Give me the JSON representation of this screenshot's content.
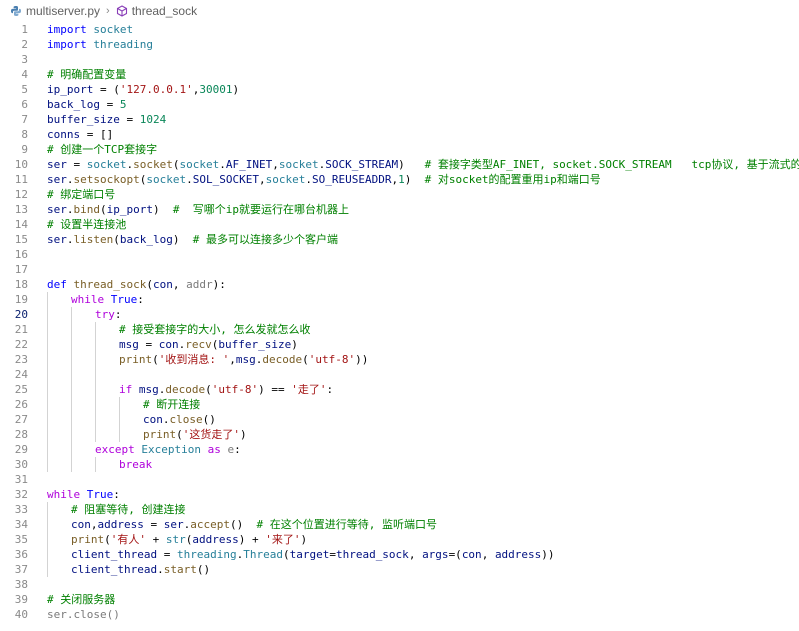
{
  "breadcrumb": {
    "file": "multiserver.py",
    "symbol": "thread_sock"
  },
  "active_line": 20,
  "lines": [
    {
      "n": "1",
      "indent": 0,
      "tokens": [
        [
          "kw",
          "import"
        ],
        [
          "txt",
          " "
        ],
        [
          "mod",
          "socket"
        ]
      ]
    },
    {
      "n": "2",
      "indent": 0,
      "tokens": [
        [
          "kw",
          "import"
        ],
        [
          "txt",
          " "
        ],
        [
          "mod",
          "threading"
        ]
      ]
    },
    {
      "n": "3",
      "indent": 0,
      "tokens": []
    },
    {
      "n": "4",
      "indent": 0,
      "tokens": [
        [
          "cmt",
          "# 明确配置变量"
        ]
      ]
    },
    {
      "n": "5",
      "indent": 0,
      "tokens": [
        [
          "var",
          "ip_port"
        ],
        [
          "txt",
          " = ("
        ],
        [
          "str",
          "'127.0.0.1'"
        ],
        [
          "txt",
          ","
        ],
        [
          "num",
          "30001"
        ],
        [
          "txt",
          ")"
        ]
      ]
    },
    {
      "n": "6",
      "indent": 0,
      "tokens": [
        [
          "var",
          "back_log"
        ],
        [
          "txt",
          " = "
        ],
        [
          "num",
          "5"
        ]
      ]
    },
    {
      "n": "7",
      "indent": 0,
      "tokens": [
        [
          "var",
          "buffer_size"
        ],
        [
          "txt",
          " = "
        ],
        [
          "num",
          "1024"
        ]
      ]
    },
    {
      "n": "8",
      "indent": 0,
      "tokens": [
        [
          "var",
          "conns"
        ],
        [
          "txt",
          " = []"
        ]
      ]
    },
    {
      "n": "9",
      "indent": 0,
      "tokens": [
        [
          "cmt",
          "# 创建一个TCP套接字"
        ]
      ]
    },
    {
      "n": "10",
      "indent": 0,
      "tokens": [
        [
          "var",
          "ser"
        ],
        [
          "txt",
          " = "
        ],
        [
          "mod",
          "socket"
        ],
        [
          "txt",
          "."
        ],
        [
          "fn",
          "socket"
        ],
        [
          "txt",
          "("
        ],
        [
          "mod",
          "socket"
        ],
        [
          "txt",
          "."
        ],
        [
          "var",
          "AF_INET"
        ],
        [
          "txt",
          ","
        ],
        [
          "mod",
          "socket"
        ],
        [
          "txt",
          "."
        ],
        [
          "var",
          "SOCK_STREAM"
        ],
        [
          "txt",
          ")   "
        ],
        [
          "cmt",
          "# 套接字类型AF_INET, socket.SOCK_STREAM   tcp协议, 基于流式的协议"
        ]
      ]
    },
    {
      "n": "11",
      "indent": 0,
      "tokens": [
        [
          "var",
          "ser"
        ],
        [
          "txt",
          "."
        ],
        [
          "fn",
          "setsockopt"
        ],
        [
          "txt",
          "("
        ],
        [
          "mod",
          "socket"
        ],
        [
          "txt",
          "."
        ],
        [
          "var",
          "SOL_SOCKET"
        ],
        [
          "txt",
          ","
        ],
        [
          "mod",
          "socket"
        ],
        [
          "txt",
          "."
        ],
        [
          "var",
          "SO_REUSEADDR"
        ],
        [
          "txt",
          ","
        ],
        [
          "num",
          "1"
        ],
        [
          "txt",
          ")  "
        ],
        [
          "cmt",
          "# 对socket的配置重用ip和端口号"
        ]
      ]
    },
    {
      "n": "12",
      "indent": 0,
      "tokens": [
        [
          "cmt",
          "# 绑定端口号"
        ]
      ]
    },
    {
      "n": "13",
      "indent": 0,
      "tokens": [
        [
          "var",
          "ser"
        ],
        [
          "txt",
          "."
        ],
        [
          "fn",
          "bind"
        ],
        [
          "txt",
          "("
        ],
        [
          "var",
          "ip_port"
        ],
        [
          "txt",
          ")  "
        ],
        [
          "cmt",
          "#  写哪个ip就要运行在哪台机器上"
        ]
      ]
    },
    {
      "n": "14",
      "indent": 0,
      "tokens": [
        [
          "cmt",
          "# 设置半连接池"
        ]
      ]
    },
    {
      "n": "15",
      "indent": 0,
      "tokens": [
        [
          "var",
          "ser"
        ],
        [
          "txt",
          "."
        ],
        [
          "fn",
          "listen"
        ],
        [
          "txt",
          "("
        ],
        [
          "var",
          "back_log"
        ],
        [
          "txt",
          ")  "
        ],
        [
          "cmt",
          "# 最多可以连接多少个客户端"
        ]
      ]
    },
    {
      "n": "16",
      "indent": 0,
      "tokens": []
    },
    {
      "n": "17",
      "indent": 0,
      "tokens": []
    },
    {
      "n": "18",
      "indent": 0,
      "tokens": [
        [
          "kw",
          "def"
        ],
        [
          "txt",
          " "
        ],
        [
          "fn",
          "thread_sock"
        ],
        [
          "txt",
          "("
        ],
        [
          "var",
          "con"
        ],
        [
          "txt",
          ", "
        ],
        [
          "param",
          "addr"
        ],
        [
          "txt",
          "):"
        ]
      ]
    },
    {
      "n": "19",
      "indent": 1,
      "tokens": [
        [
          "kwc",
          "while"
        ],
        [
          "txt",
          " "
        ],
        [
          "kw",
          "True"
        ],
        [
          "txt",
          ":"
        ]
      ]
    },
    {
      "n": "20",
      "indent": 2,
      "tokens": [
        [
          "kwc",
          "try"
        ],
        [
          "txt",
          ":"
        ]
      ]
    },
    {
      "n": "21",
      "indent": 3,
      "tokens": [
        [
          "cmt",
          "# 接受套接字的大小, 怎么发就怎么收"
        ]
      ]
    },
    {
      "n": "22",
      "indent": 3,
      "tokens": [
        [
          "var",
          "msg"
        ],
        [
          "txt",
          " = "
        ],
        [
          "var",
          "con"
        ],
        [
          "txt",
          "."
        ],
        [
          "fn",
          "recv"
        ],
        [
          "txt",
          "("
        ],
        [
          "var",
          "buffer_size"
        ],
        [
          "txt",
          ")"
        ]
      ]
    },
    {
      "n": "23",
      "indent": 3,
      "tokens": [
        [
          "fn",
          "print"
        ],
        [
          "txt",
          "("
        ],
        [
          "str",
          "'收到消息: '"
        ],
        [
          "txt",
          ","
        ],
        [
          "var",
          "msg"
        ],
        [
          "txt",
          "."
        ],
        [
          "fn",
          "decode"
        ],
        [
          "txt",
          "("
        ],
        [
          "str",
          "'utf-8'"
        ],
        [
          "txt",
          "))"
        ]
      ]
    },
    {
      "n": "24",
      "indent": 3,
      "tokens": []
    },
    {
      "n": "25",
      "indent": 3,
      "tokens": [
        [
          "kwc",
          "if"
        ],
        [
          "txt",
          " "
        ],
        [
          "var",
          "msg"
        ],
        [
          "txt",
          "."
        ],
        [
          "fn",
          "decode"
        ],
        [
          "txt",
          "("
        ],
        [
          "str",
          "'utf-8'"
        ],
        [
          "txt",
          ") == "
        ],
        [
          "str",
          "'走了'"
        ],
        [
          "txt",
          ":"
        ]
      ]
    },
    {
      "n": "26",
      "indent": 4,
      "tokens": [
        [
          "cmt",
          "# 断开连接"
        ]
      ]
    },
    {
      "n": "27",
      "indent": 4,
      "tokens": [
        [
          "var",
          "con"
        ],
        [
          "txt",
          "."
        ],
        [
          "fn",
          "close"
        ],
        [
          "txt",
          "()"
        ]
      ]
    },
    {
      "n": "28",
      "indent": 4,
      "tokens": [
        [
          "fn",
          "print"
        ],
        [
          "txt",
          "("
        ],
        [
          "str",
          "'这货走了'"
        ],
        [
          "txt",
          ")"
        ]
      ]
    },
    {
      "n": "29",
      "indent": 2,
      "tokens": [
        [
          "kwc",
          "except"
        ],
        [
          "txt",
          " "
        ],
        [
          "cls",
          "Exception"
        ],
        [
          "txt",
          " "
        ],
        [
          "kwc",
          "as"
        ],
        [
          "txt",
          " "
        ],
        [
          "param",
          "e"
        ],
        [
          "txt",
          ":"
        ]
      ]
    },
    {
      "n": "30",
      "indent": 3,
      "tokens": [
        [
          "kwc",
          "break"
        ]
      ]
    },
    {
      "n": "31",
      "indent": 0,
      "tokens": []
    },
    {
      "n": "32",
      "indent": 0,
      "tokens": [
        [
          "kwc",
          "while"
        ],
        [
          "txt",
          " "
        ],
        [
          "kw",
          "True"
        ],
        [
          "txt",
          ":"
        ]
      ]
    },
    {
      "n": "33",
      "indent": 1,
      "tokens": [
        [
          "cmt",
          "# 阻塞等待, 创建连接"
        ]
      ]
    },
    {
      "n": "34",
      "indent": 1,
      "tokens": [
        [
          "var",
          "con"
        ],
        [
          "txt",
          ","
        ],
        [
          "var",
          "address"
        ],
        [
          "txt",
          " = "
        ],
        [
          "var",
          "ser"
        ],
        [
          "txt",
          "."
        ],
        [
          "fn",
          "accept"
        ],
        [
          "txt",
          "()  "
        ],
        [
          "cmt",
          "# 在这个位置进行等待, 监听端口号"
        ]
      ]
    },
    {
      "n": "35",
      "indent": 1,
      "tokens": [
        [
          "fn",
          "print"
        ],
        [
          "txt",
          "("
        ],
        [
          "str",
          "'有人'"
        ],
        [
          "txt",
          " + "
        ],
        [
          "cls",
          "str"
        ],
        [
          "txt",
          "("
        ],
        [
          "var",
          "address"
        ],
        [
          "txt",
          ") + "
        ],
        [
          "str",
          "'来了'"
        ],
        [
          "txt",
          ")"
        ]
      ]
    },
    {
      "n": "36",
      "indent": 1,
      "tokens": [
        [
          "var",
          "client_thread"
        ],
        [
          "txt",
          " = "
        ],
        [
          "mod",
          "threading"
        ],
        [
          "txt",
          "."
        ],
        [
          "cls",
          "Thread"
        ],
        [
          "txt",
          "("
        ],
        [
          "var",
          "target"
        ],
        [
          "txt",
          "="
        ],
        [
          "var",
          "thread_sock"
        ],
        [
          "txt",
          ", "
        ],
        [
          "var",
          "args"
        ],
        [
          "txt",
          "=("
        ],
        [
          "var",
          "con"
        ],
        [
          "txt",
          ", "
        ],
        [
          "var",
          "address"
        ],
        [
          "txt",
          "))"
        ]
      ]
    },
    {
      "n": "37",
      "indent": 1,
      "tokens": [
        [
          "var",
          "client_thread"
        ],
        [
          "txt",
          "."
        ],
        [
          "fn",
          "start"
        ],
        [
          "txt",
          "()"
        ]
      ]
    },
    {
      "n": "38",
      "indent": 0,
      "tokens": []
    },
    {
      "n": "39",
      "indent": 0,
      "tokens": [
        [
          "cmt",
          "# 关闭服务器"
        ]
      ]
    },
    {
      "n": "40",
      "indent": 0,
      "tokens": [
        [
          "dim",
          "ser.close()"
        ]
      ]
    }
  ]
}
